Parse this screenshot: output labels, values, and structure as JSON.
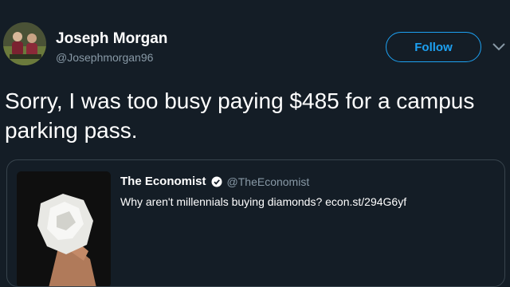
{
  "tweet": {
    "display_name": "Joseph Morgan",
    "handle": "@Josephmorgan96",
    "follow_label": "Follow",
    "text": "Sorry, I was too busy paying $485 for a campus parking pass.",
    "icons": {
      "avatar": "profile-photo",
      "caret": "chevron-down-icon"
    }
  },
  "quoted_tweet": {
    "display_name": "The Economist",
    "handle": "@TheEconomist",
    "text": "Why aren't millennials buying diamonds? econ.st/294G6yf",
    "icons": {
      "verified": "verified-badge-icon",
      "media": "diamond-photo"
    }
  },
  "colors": {
    "background": "#141d26",
    "accent": "#1da1f2",
    "secondary_text": "#8899a6",
    "border": "#38444d"
  }
}
